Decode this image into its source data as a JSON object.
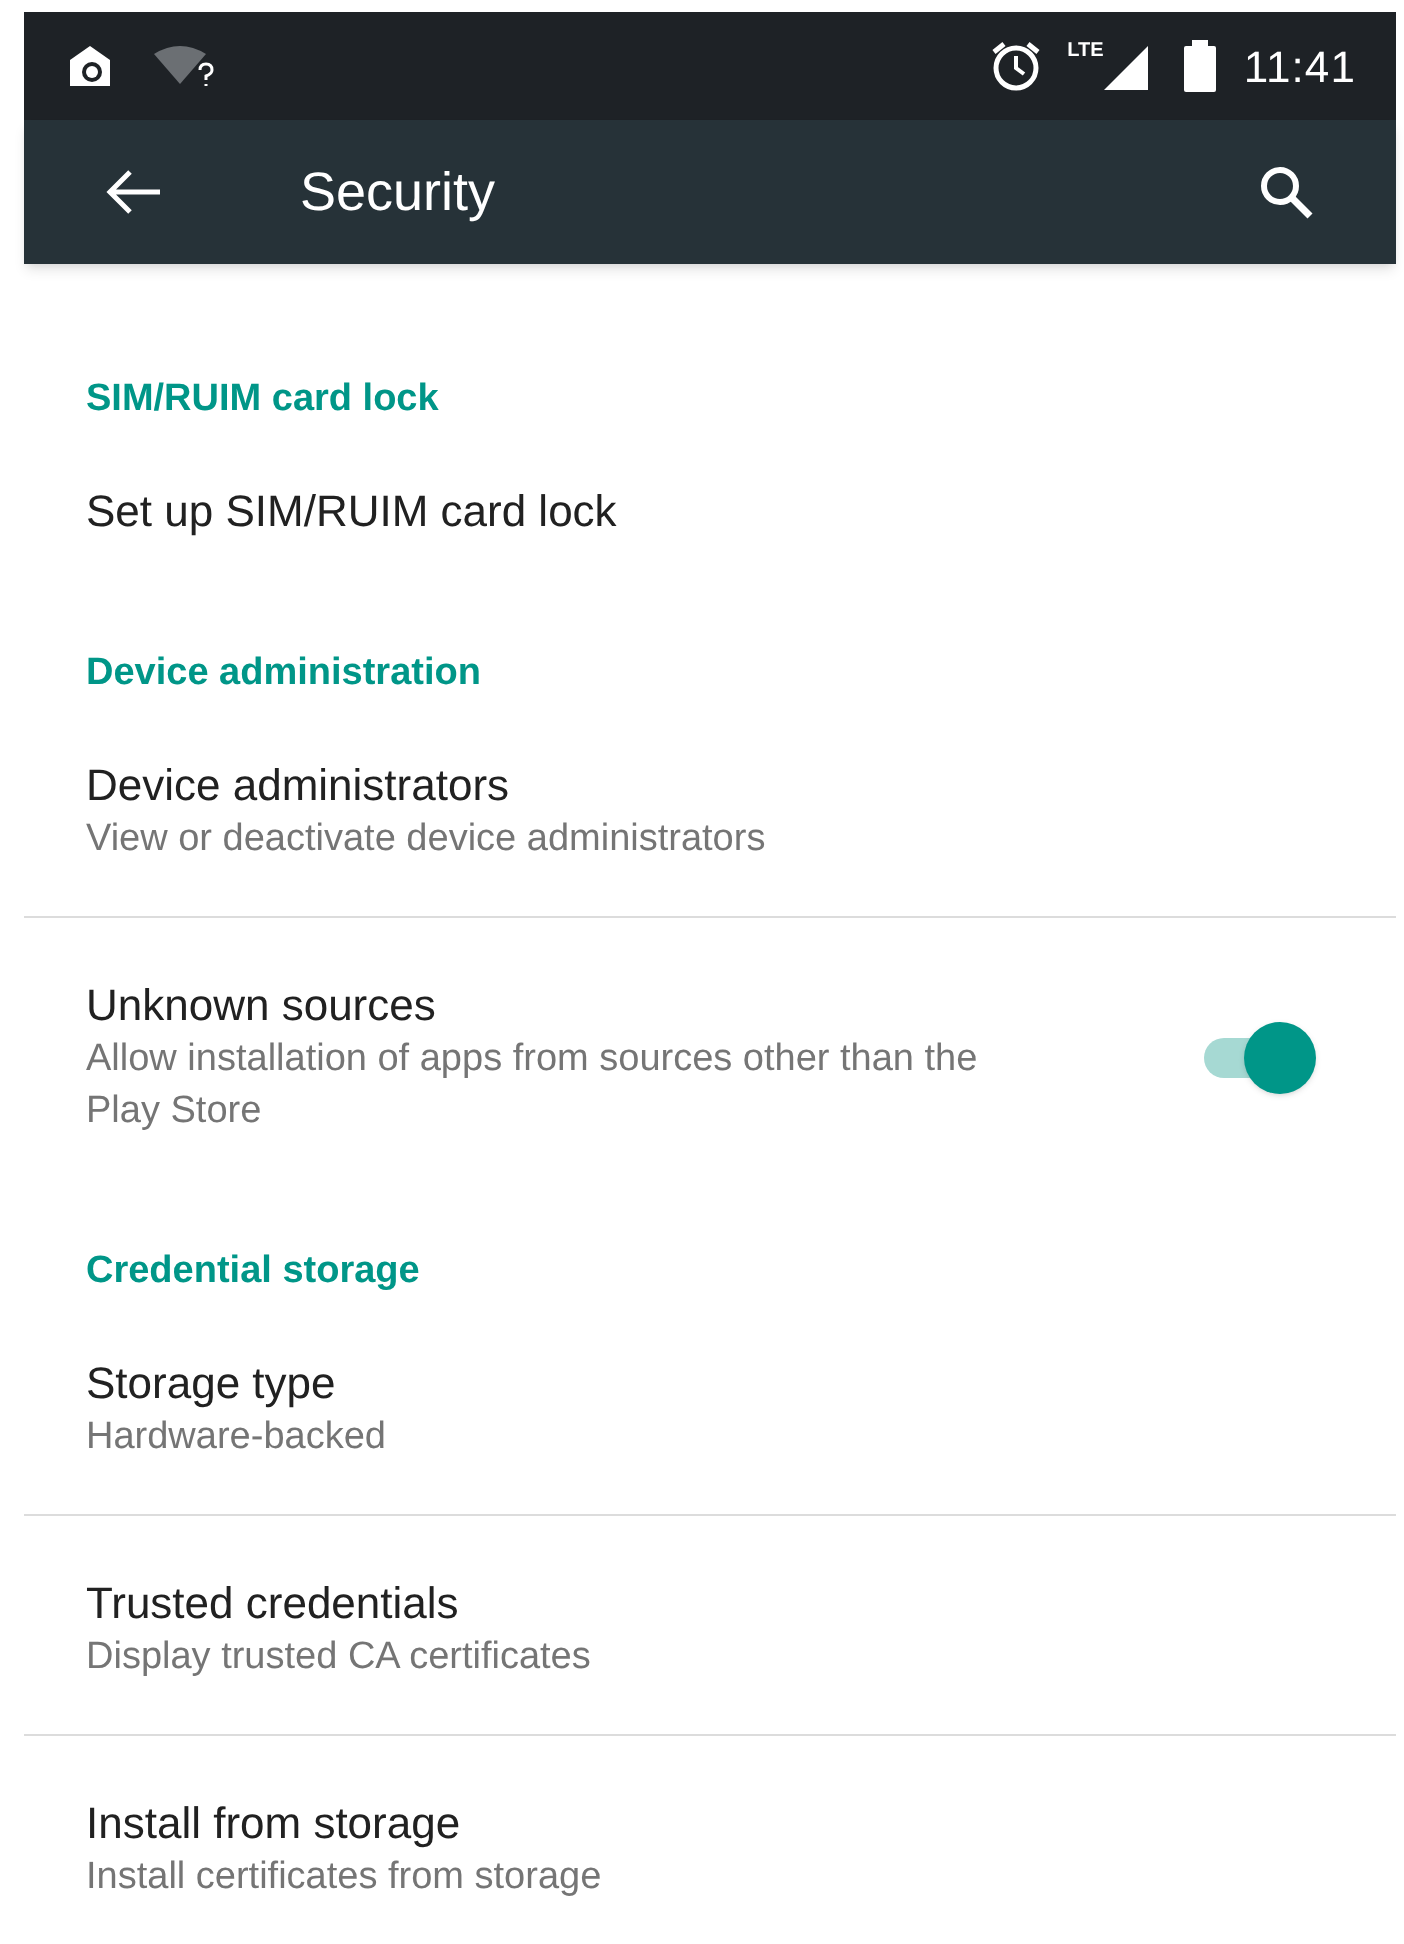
{
  "status_bar": {
    "network": "LTE",
    "time": "11:41"
  },
  "toolbar": {
    "title": "Security"
  },
  "sections": [
    {
      "title": "SIM/RUIM card lock",
      "items": [
        {
          "kind": "plain",
          "title": "Set up SIM/RUIM card lock"
        }
      ]
    },
    {
      "title": "Device administration",
      "items": [
        {
          "kind": "plain",
          "title": "Device administrators",
          "summary": "View or deactivate device administrators"
        },
        {
          "kind": "toggle",
          "title": "Unknown sources",
          "summary": "Allow installation of apps from sources other than the Play Store",
          "on": true
        }
      ]
    },
    {
      "title": "Credential storage",
      "items": [
        {
          "kind": "plain",
          "title": "Storage type",
          "summary": "Hardware-backed"
        },
        {
          "kind": "plain",
          "title": "Trusted credentials",
          "summary": "Display trusted CA certificates"
        },
        {
          "kind": "plain",
          "title": "Install from storage",
          "summary": "Install certificates from storage"
        }
      ]
    }
  ]
}
